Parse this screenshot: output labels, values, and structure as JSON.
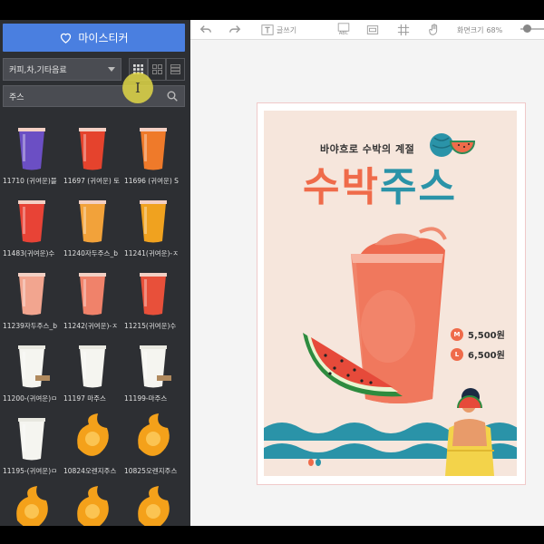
{
  "sidebar": {
    "sticker_button": "마이스티커",
    "category": "커피,차,기타음료",
    "search": {
      "value": "주스",
      "placeholder": ""
    },
    "items": [
      {
        "label": "11710 (귀여운)블",
        "color": "#6b4fc4"
      },
      {
        "label": "11697 (귀여운) 토",
        "color": "#e5432d"
      },
      {
        "label": "11696 (귀여운) S",
        "color": "#ef7a2a"
      },
      {
        "label": "11483(귀여운)수",
        "color": "#e84336"
      },
      {
        "label": "11240자두주스_b",
        "color": "#f2a23a"
      },
      {
        "label": "11241(귀여운)-ㅈ",
        "color": "#f0a21f"
      },
      {
        "label": "11239자두주스_b",
        "color": "#f2a58f"
      },
      {
        "label": "11242(귀여운)-ㅈ",
        "color": "#f0826a"
      },
      {
        "label": "11215(귀여운)수",
        "color": "#e8503a"
      },
      {
        "label": "11200-(귀여운)ㅁ",
        "color": "#f5f5f0"
      },
      {
        "label": "11197 마주스",
        "color": "#f5f5f0"
      },
      {
        "label": "11199-마주스",
        "color": "#f5f5f0"
      },
      {
        "label": "11195-(귀여운)ㅁ",
        "color": "#f5f5f0"
      },
      {
        "label": "10824오렌지주스",
        "color": "#f4a11a"
      },
      {
        "label": "10825오렌지주스",
        "color": "#f4a11a"
      },
      {
        "label": "",
        "color": "#f4a11a"
      },
      {
        "label": "",
        "color": "#f4a11a"
      },
      {
        "label": "",
        "color": "#f4a11a"
      }
    ]
  },
  "toolbar": {
    "text_tool": "글쓰기",
    "abc": "ABC",
    "zoom_label": "화면크기",
    "zoom_value": "68%"
  },
  "poster": {
    "subtitle": "바야흐로 수박의 계절",
    "title_part1": "수박",
    "title_part2": "주스",
    "price_m_badge": "M",
    "price_m": "5,500원",
    "price_l_badge": "L",
    "price_l": "6,500원"
  },
  "colors": {
    "accent_blue": "#4a7fe0",
    "title_orange": "#ef6b4a",
    "title_teal": "#2a93a8"
  }
}
